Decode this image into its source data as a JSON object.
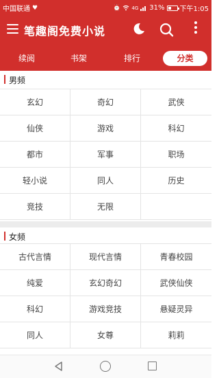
{
  "status_bar": {
    "carrier": "中国联通",
    "network": "4G",
    "battery": "31%",
    "battery_level": 0.31,
    "time": "下午1:05"
  },
  "app_bar": {
    "title": "笔趣阁免费小说",
    "icons": [
      "menu-icon",
      "moon-icon",
      "search-icon",
      "more-icon"
    ]
  },
  "tabs": [
    {
      "label": "续阅",
      "active": false
    },
    {
      "label": "书架",
      "active": false
    },
    {
      "label": "排行",
      "active": false
    },
    {
      "label": "分类",
      "active": true
    }
  ],
  "sections": [
    {
      "title": "男频",
      "categories": [
        "玄幻",
        "奇幻",
        "武侠",
        "仙侠",
        "游戏",
        "科幻",
        "都市",
        "军事",
        "职场",
        "轻小说",
        "同人",
        "历史",
        "竞技",
        "无限"
      ]
    },
    {
      "title": "女频",
      "categories": [
        "古代言情",
        "现代言情",
        "青春校园",
        "纯爱",
        "玄幻奇幻",
        "武侠仙侠",
        "科幻",
        "游戏竞技",
        "悬疑灵异",
        "同人",
        "女尊",
        "莉莉"
      ]
    }
  ],
  "colors": {
    "accent": "#d12f2c",
    "text": "#444444",
    "grid_line": "#e4e4e4"
  }
}
